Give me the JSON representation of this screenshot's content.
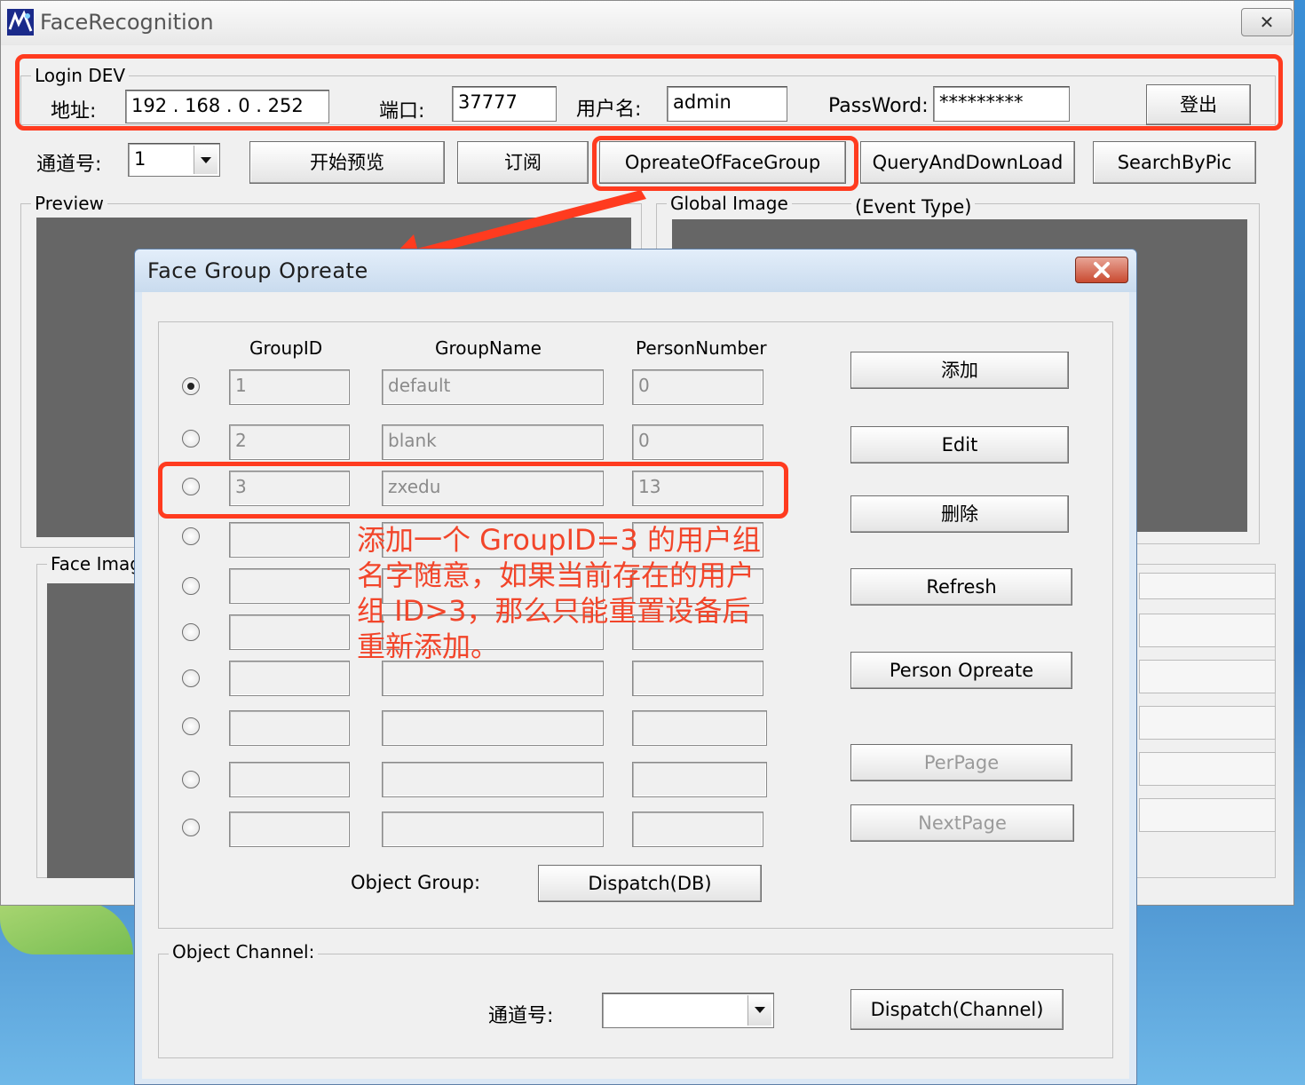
{
  "main": {
    "title": "FaceRecognition",
    "close_glyph": "✕",
    "login": {
      "legend": "Login DEV",
      "addr_label": "地址:",
      "addr_value": "192 . 168 .  0   . 252",
      "port_label": "端口:",
      "port_value": "37777",
      "user_label": "用户名:",
      "user_value": "admin",
      "pass_label": "PassWord:",
      "pass_value": "*********",
      "logout_button": "登出"
    },
    "channel_label": "通道号:",
    "channel_value": "1",
    "buttons": {
      "start_preview": "开始预览",
      "subscribe": "订阅",
      "face_group": "OpreateOfFaceGroup",
      "query_download": "QueryAndDownLoad",
      "search_by_pic": "SearchByPic"
    },
    "preview_legend": "Preview",
    "global_image_legend": "Global Image",
    "event_type": "(Event Type)",
    "face_image_legend": "Face Imag"
  },
  "dialog": {
    "title": "Face Group Opreate",
    "columns": [
      "GroupID",
      "GroupName",
      "PersonNumber"
    ],
    "rows": [
      {
        "id": "1",
        "name": "default",
        "count": "0"
      },
      {
        "id": "2",
        "name": "blank",
        "count": "0"
      },
      {
        "id": "3",
        "name": "zxedu",
        "count": "13"
      },
      {
        "id": "",
        "name": "",
        "count": ""
      },
      {
        "id": "",
        "name": "",
        "count": ""
      },
      {
        "id": "",
        "name": "",
        "count": ""
      },
      {
        "id": "",
        "name": "",
        "count": ""
      },
      {
        "id": "",
        "name": "",
        "count": ""
      },
      {
        "id": "",
        "name": "",
        "count": ""
      },
      {
        "id": "",
        "name": "",
        "count": ""
      }
    ],
    "buttons": {
      "add": "添加",
      "edit": "Edit",
      "delete": "删除",
      "refresh": "Refresh",
      "person_operate": "Person Opreate",
      "per_page": "PerPage",
      "next_page": "NextPage",
      "dispatch_db": "Dispatch(DB)",
      "dispatch_channel": "Dispatch(Channel)"
    },
    "object_group_label": "Object Group:",
    "object_channel_legend": "Object Channel:",
    "channel_label": "通道号:",
    "channel_value": ""
  },
  "annotation": {
    "text": "添加一个 GroupID=3 的用户组名字随意，如果当前存在的用户组 ID>3，那么只能重置设备后重新添加。",
    "line1": "添加一个 GroupID=3 的用户组",
    "line2": "名字随意，如果当前存在的用户",
    "line3": "组 ID>3，那么只能重置设备后",
    "line4": "重新添加。",
    "color": "#f2452a"
  }
}
